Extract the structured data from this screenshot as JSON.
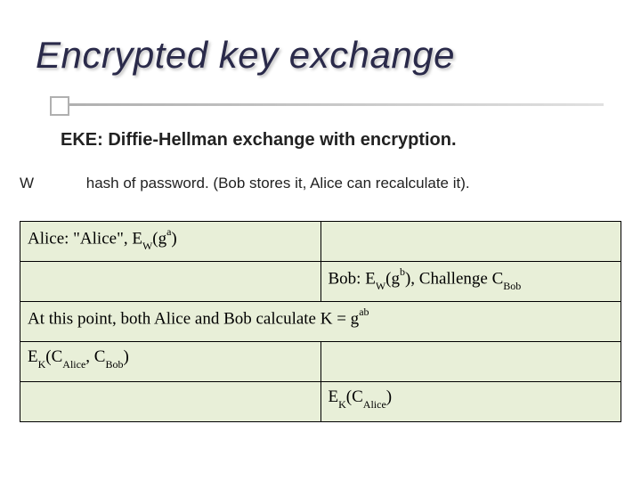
{
  "slide": {
    "title": "Encrypted key exchange",
    "subtitle": "EKE: Diffie-Hellman exchange with encryption.",
    "definition": {
      "label": "W",
      "text": "hash of password. (Bob stores it, Alice can recalculate it)."
    },
    "protocol": {
      "row1": {
        "alice_prefix": "Alice: \"Alice\", E",
        "alice_sub1": "W",
        "alice_mid": "(g",
        "alice_sup1": "a",
        "alice_suffix": ")"
      },
      "row2": {
        "bob_prefix": "Bob: E",
        "bob_sub1": "W",
        "bob_mid1": "(g",
        "bob_sup1": "b",
        "bob_mid2": "), Challenge C",
        "bob_sub2": "Bob"
      },
      "row3": {
        "full_prefix": "At this point, both Alice and Bob calculate K = g",
        "full_sup": "ab"
      },
      "row4": {
        "alice_prefix": "E",
        "alice_sub1": "K",
        "alice_mid1": "(C",
        "alice_sub2": "Alice",
        "alice_mid2": ", C",
        "alice_sub3": "Bob",
        "alice_suffix": ")"
      },
      "row5": {
        "bob_prefix": "E",
        "bob_sub1": "K",
        "bob_mid1": "(C",
        "bob_sub2": "Alice",
        "bob_suffix": ")"
      }
    }
  }
}
